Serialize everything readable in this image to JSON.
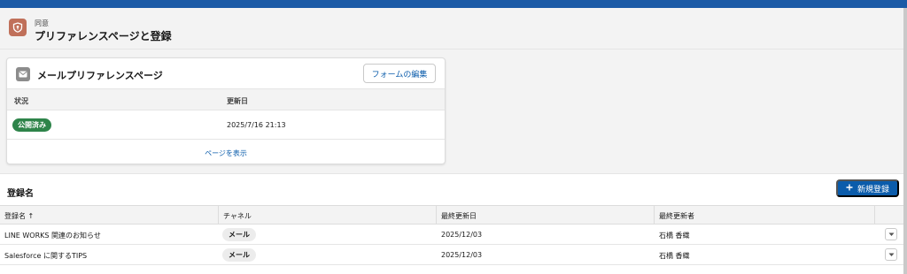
{
  "header": {
    "eyebrow": "同意",
    "title": "プリファレンスページと登録",
    "icon": "shield-icon"
  },
  "card": {
    "title": "メールプリファレンスページ",
    "icon": "envelope-icon",
    "edit_button": "フォームの編集",
    "columns": [
      "状況",
      "更新日"
    ],
    "row": {
      "status": "公開済み",
      "updated": "2025/7/16 21:13"
    },
    "footer_link": "ページを表示"
  },
  "registrations": {
    "title": "登録名",
    "new_button": "新規登録",
    "columns": [
      "登録名 ↑",
      "チャネル",
      "最終更新日",
      "最終更新者"
    ],
    "rows": [
      {
        "name": "LINE WORKS 関連のお知らせ",
        "channel": "メール",
        "updated": "2025/12/03",
        "updated_by": "石橋 香織"
      },
      {
        "name": "Salesforce に関するTIPS",
        "channel": "メール",
        "updated": "2025/12/03",
        "updated_by": "石橋 香織"
      }
    ]
  },
  "colors": {
    "brand": "#0b5cab",
    "success": "#2e844a",
    "header_icon_bg": "#c0705a",
    "top_strip": "#1b5aa6"
  }
}
